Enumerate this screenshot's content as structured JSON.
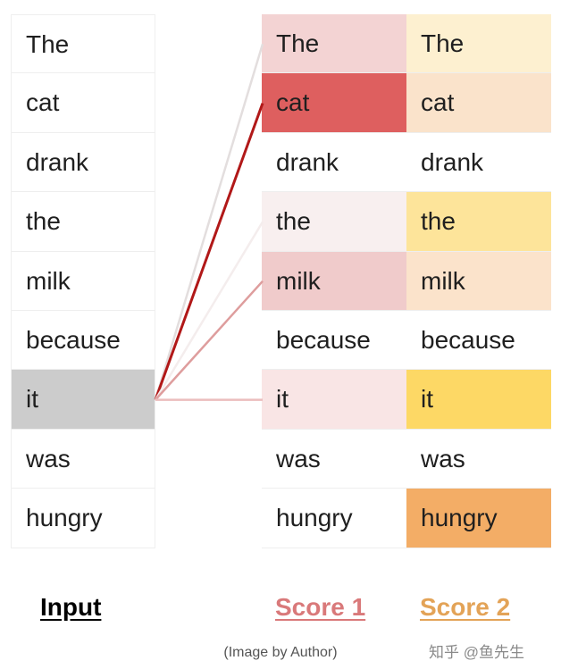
{
  "columns": {
    "input": {
      "label": "Input",
      "label_color": "#000000",
      "selected_index": 6,
      "selected_color": "#cccccc",
      "words": [
        "The",
        "cat",
        "drank",
        "the",
        "milk",
        "because",
        "it",
        "was",
        "hungry"
      ]
    },
    "score1": {
      "label": "Score 1",
      "label_color": "#d9797a",
      "words": [
        "The",
        "cat",
        "drank",
        "the",
        "milk",
        "because",
        "it",
        "was",
        "hungry"
      ],
      "colors": [
        "#f3d3d3",
        "#de5f5f",
        "#ffffff",
        "#f8efef",
        "#f0cbcb",
        "#ffffff",
        "#f9e5e5",
        "#ffffff",
        "#ffffff"
      ]
    },
    "score2": {
      "label": "Score 2",
      "label_color": "#e3a357",
      "words": [
        "The",
        "cat",
        "drank",
        "the",
        "milk",
        "because",
        "it",
        "was",
        "hungry"
      ],
      "colors": [
        "#fdf0d0",
        "#fae3cb",
        "#ffffff",
        "#fde49a",
        "#fbe3cb",
        "#ffffff",
        "#fdd865",
        "#ffffff",
        "#f3ad66"
      ]
    }
  },
  "attention_links": [
    {
      "target_index": 0,
      "color": "#e3dede"
    },
    {
      "target_index": 1,
      "color": "#b11818"
    },
    {
      "target_index": 3,
      "color": "#f4eded"
    },
    {
      "target_index": 4,
      "color": "#de9d9d"
    },
    {
      "target_index": 6,
      "color": "#ebbdbd"
    }
  ],
  "caption": "(Image by Author)",
  "watermark": "知乎 @鱼先生"
}
